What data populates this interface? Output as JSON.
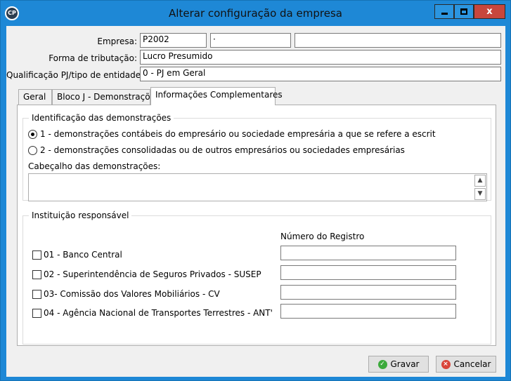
{
  "window": {
    "title": "Alterar configuração da empresa",
    "app_icon_text": "CP",
    "close_glyph": "x"
  },
  "form": {
    "empresa_label": "Empresa:",
    "empresa_code": "P2002",
    "empresa_field2": "·",
    "empresa_field3": "",
    "tributacao_label": "Forma de tributação:",
    "tributacao_value": "Lucro Presumido",
    "qualificacao_label": "Qualificação PJ/tipo de entidade:",
    "qualificacao_value": "0 - PJ em Geral"
  },
  "tabs": [
    {
      "label": "Geral"
    },
    {
      "label": "Bloco J - Demonstrações"
    },
    {
      "label": "Informações Complementares",
      "active": true
    }
  ],
  "demonstracoes": {
    "group_title": "Identificação das demonstrações",
    "option1": "1 - demonstrações contábeis do empresário ou sociedade empresária a que se refere a escrit",
    "option2": "2 - demonstrações consolidadas ou de outros empresários ou sociedades empresárias",
    "selected": 1,
    "cabecalho_label": "Cabeçalho das demonstrações:",
    "cabecalho_value": ""
  },
  "instituicao": {
    "group_title": "Instituição responsável",
    "registro_header": "Número do Registro",
    "items": [
      {
        "label": "01 - Banco Central",
        "checked": false,
        "registro": ""
      },
      {
        "label": "02 - Superintendência de Seguros Privados - SUSEP",
        "checked": false,
        "registro": ""
      },
      {
        "label": "03- Comissão dos Valores Mobiliários - CV",
        "checked": false,
        "registro": ""
      },
      {
        "label": "04 - Agência Nacional de Transportes Terrestres - ANT'",
        "checked": false,
        "registro": ""
      }
    ]
  },
  "buttons": {
    "gravar": "Gravar",
    "cancelar": "Cancelar"
  },
  "colors": {
    "titlebar": "#1e88d6",
    "close_button": "#c7463c",
    "ok_icon": "#3caa3c",
    "cancel_icon": "#d9453a"
  }
}
